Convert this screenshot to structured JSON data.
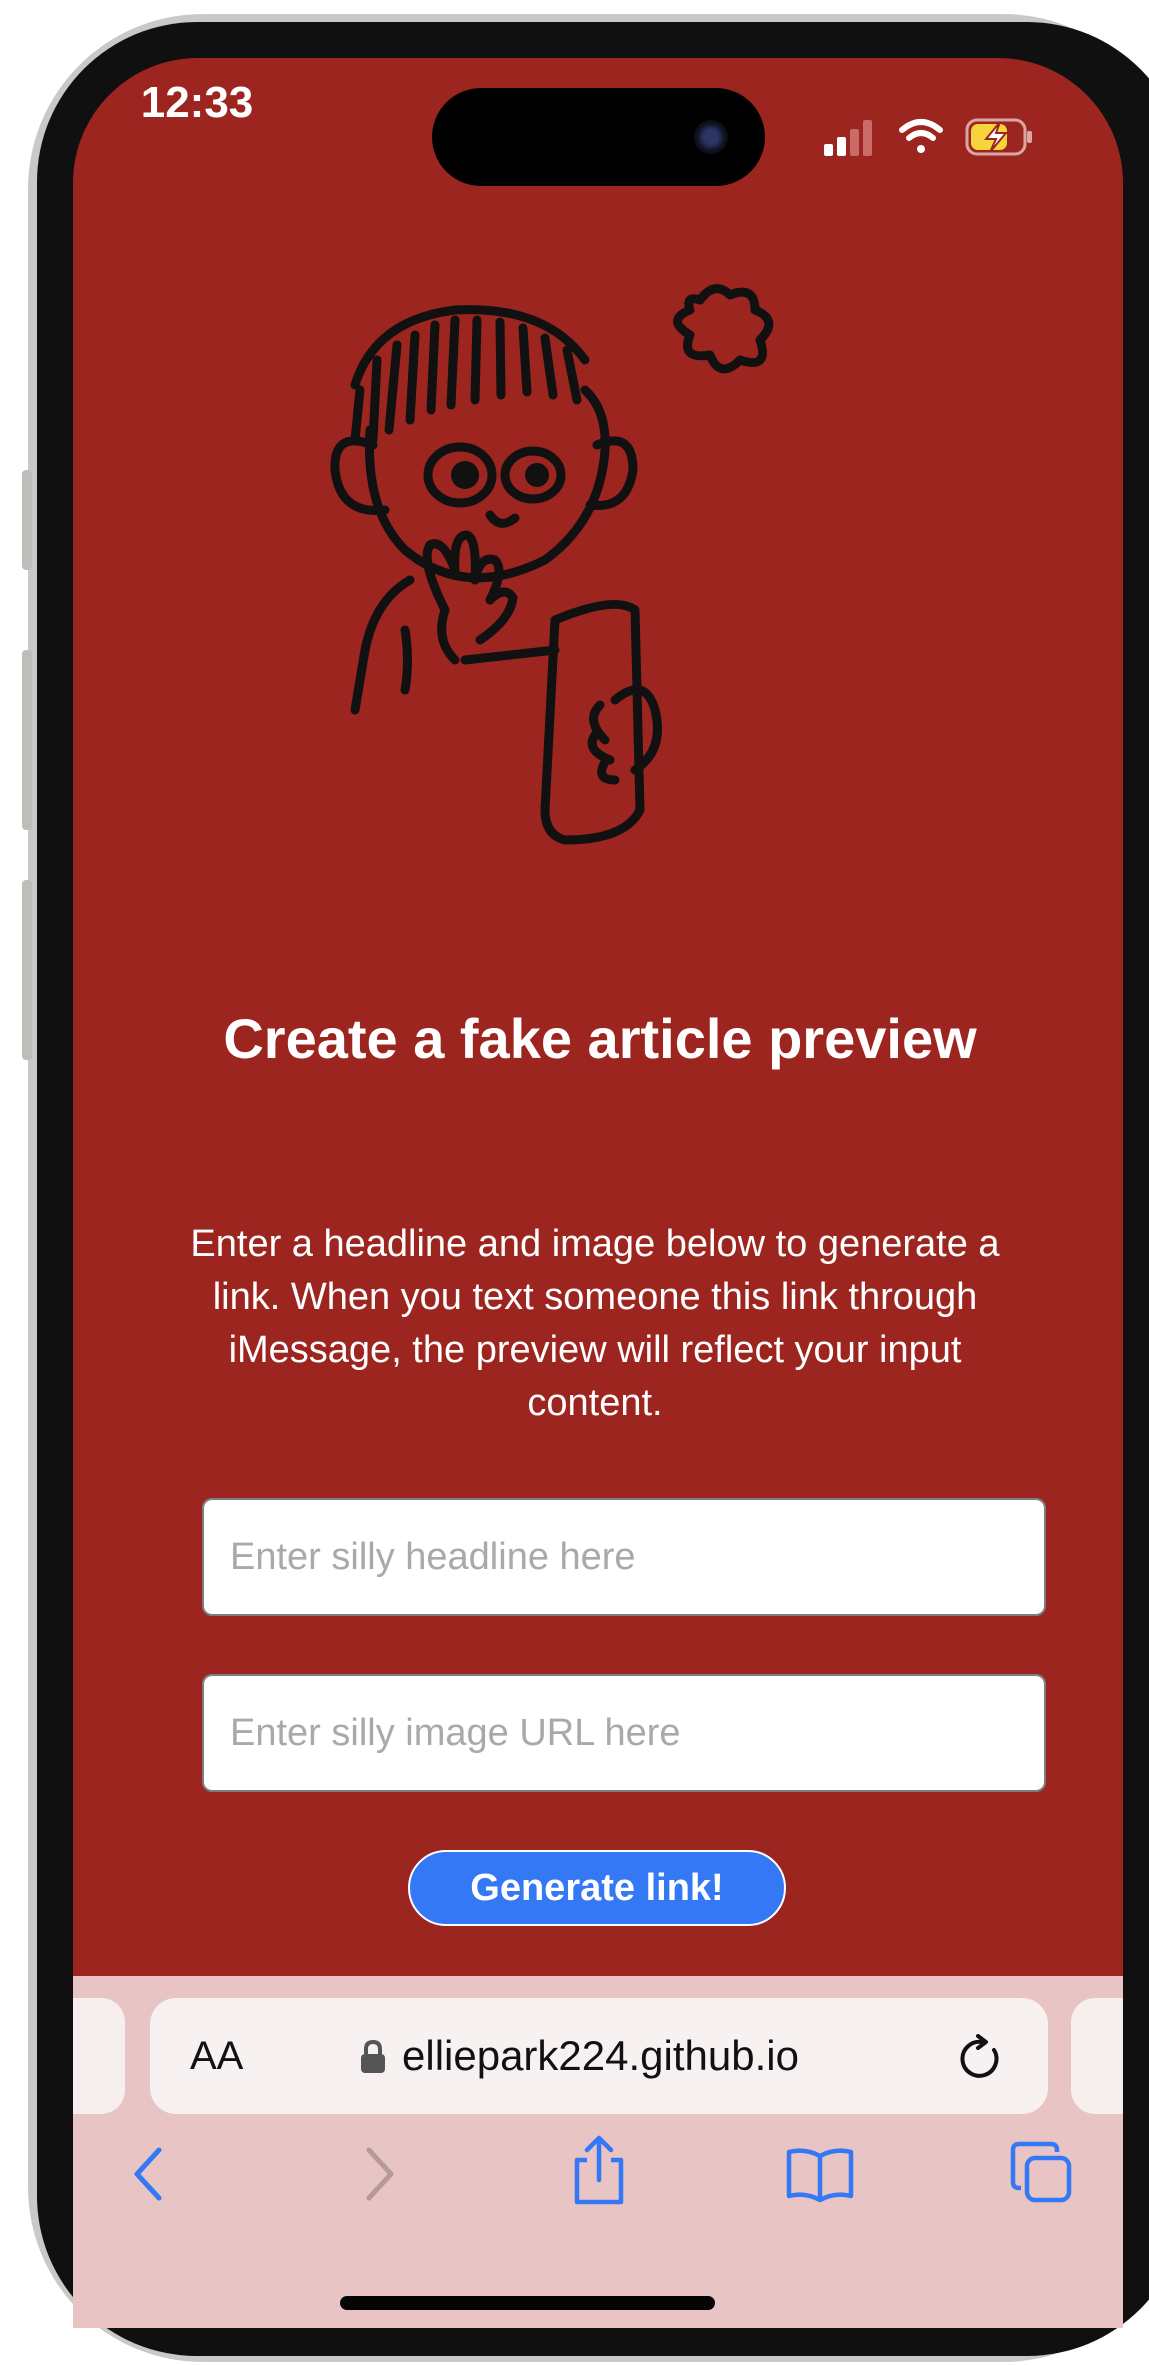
{
  "status_bar": {
    "time": "12:33",
    "icons": [
      "cellular-signal-icon",
      "wifi-icon",
      "battery-charging-icon"
    ],
    "battery_color": "#f5d53b"
  },
  "page": {
    "background_color": "#9d2520",
    "illustration": "person-with-phone-doodle",
    "title": "Create a fake article preview",
    "description": "Enter a headline and image below to generate a link. When you text someone this link through iMessage, the preview will reflect your input content.",
    "headline_input": {
      "value": "",
      "placeholder": "Enter silly headline here"
    },
    "image_input": {
      "value": "",
      "placeholder": "Enter silly image URL here"
    },
    "generate_button": {
      "label": "Generate link!",
      "color": "#3478f6"
    }
  },
  "browser": {
    "reader_button": "AA",
    "url": "elliepark224.github.io",
    "toolbar": [
      "back-icon",
      "forward-icon",
      "share-icon",
      "bookmarks-icon",
      "tabs-icon"
    ],
    "accent_color": "#3478f6"
  }
}
